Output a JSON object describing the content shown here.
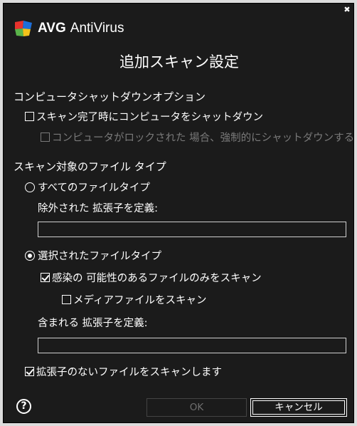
{
  "window": {
    "brand": "AVG",
    "product": "AntiVirus",
    "close_glyph": "✖"
  },
  "title": "追加スキャン設定",
  "shutdown_section": {
    "heading": "コンピュータシャットダウンオプション",
    "shutdown_on_complete": {
      "label": "スキャン完了時にコンピュータをシャットダウン",
      "checked": false
    },
    "force_shutdown_if_locked": {
      "label": "コンピュータがロックされた 場合、強制的にシャットダウンする",
      "checked": false,
      "disabled": true
    }
  },
  "filetypes_section": {
    "heading": "スキャン対象のファイル タイプ",
    "all_types": {
      "label": "すべてのファイルタイプ",
      "selected": false
    },
    "exclude_label": "除外された 拡張子を定義:",
    "exclude_value": "",
    "selected_types": {
      "label": "選択されたファイルタイプ",
      "selected": true
    },
    "infectable_only": {
      "label": "感染の 可能性のあるファイルのみをスキャン",
      "checked": true
    },
    "media_files": {
      "label": "メディアファイルをスキャン",
      "checked": false
    },
    "include_label": "含まれる 拡張子を定義:",
    "include_value": "",
    "no_extension": {
      "label": "拡張子のないファイルをスキャンします",
      "checked": true
    }
  },
  "footer": {
    "help_glyph": "?",
    "ok_label": "OK",
    "cancel_label": "キャンセル"
  },
  "colors": {
    "background": "#1b1b1b",
    "text": "#ffffff",
    "disabled_text": "#7a7a7a",
    "logo_red": "#e8322d",
    "logo_blue": "#1e6fd9",
    "logo_green": "#5ab44a",
    "logo_yellow": "#f2c21b"
  },
  "icons": [
    "avg-logo-icon",
    "close-icon",
    "help-icon",
    "checkbox-icon",
    "radio-icon"
  ]
}
